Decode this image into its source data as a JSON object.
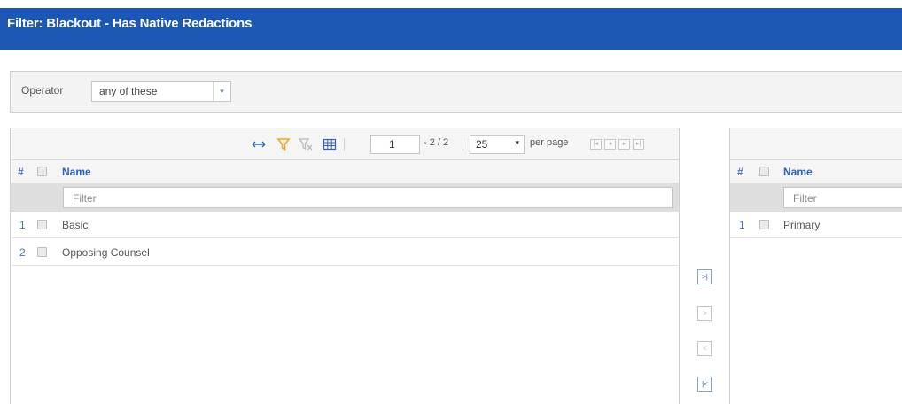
{
  "titlebar": {
    "title": "Filter: Blackout - Has Native Redactions"
  },
  "operator": {
    "label": "Operator",
    "selected": "any of these",
    "arrow": "▾"
  },
  "available_grid": {
    "toolbar": {
      "icons": [
        "resize-icon",
        "filter-icon",
        "clear-filter-icon",
        "columns-icon"
      ],
      "page_value": "1",
      "page_range": "- 2 / 2",
      "per_page_value": "25",
      "per_page_arrow": "▾",
      "per_page_label": "per page",
      "pager_buttons": [
        "first",
        "prev",
        "next",
        "last"
      ]
    },
    "columns": {
      "num_header": "#",
      "name_header": "Name"
    },
    "filter_placeholder": "Filter",
    "rows": [
      {
        "num": "1",
        "name": "Basic"
      },
      {
        "num": "2",
        "name": "Opposing Counsel"
      }
    ]
  },
  "move_buttons": [
    {
      "name": "move-all-right-button",
      "glyph": ">|",
      "enabled": true
    },
    {
      "name": "move-right-button",
      "glyph": ">",
      "enabled": false
    },
    {
      "name": "move-left-button",
      "glyph": "<",
      "enabled": false
    },
    {
      "name": "move-all-left-button",
      "glyph": "|<",
      "enabled": true
    }
  ],
  "selected_grid": {
    "columns": {
      "num_header": "#",
      "name_header": "Name"
    },
    "filter_placeholder": "Filter",
    "rows": [
      {
        "num": "1",
        "name": "Primary"
      }
    ]
  },
  "colors": {
    "title_bar": "#1b57b3",
    "link_blue": "#2f62b5",
    "filter_orange": "#f5a623"
  }
}
